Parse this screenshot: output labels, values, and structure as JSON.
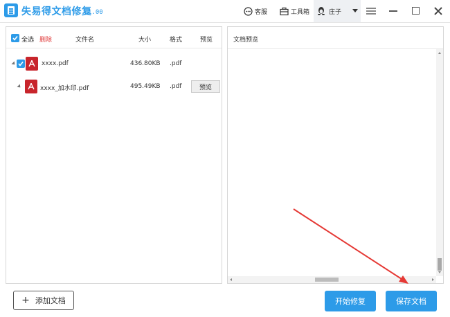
{
  "titlebar": {
    "title": "失易得文档修复",
    "version": "1.00",
    "kefu_label": "客服",
    "tools_label": "工具箱",
    "user_name": "庄子"
  },
  "file_list": {
    "select_all_label": "全选",
    "delete_label": "删除",
    "columns": [
      "文件名",
      "大小",
      "格式",
      "预览"
    ],
    "rows": [
      {
        "name": "xxxx.pdf",
        "size": "436.80KB",
        "format": ".pdf",
        "checked": true,
        "has_preview": false
      },
      {
        "name": "xxxx_加水印.pdf",
        "size": "495.49KB",
        "format": ".pdf",
        "checked": false,
        "has_preview": true,
        "preview_label": "预览"
      }
    ]
  },
  "preview_panel": {
    "title": "文档预览"
  },
  "footer": {
    "add_label": "添加文档",
    "start_label": "开始修复",
    "save_label": "保存文档"
  },
  "colors": {
    "accent": "#2d9be8",
    "delete": "#e03b3b",
    "pdf": "#c8252c",
    "annotation_arrow": "#e53935"
  },
  "icons": [
    "app-logo-icon",
    "chat-icon",
    "toolbox-icon",
    "penguin-user-icon",
    "chevron-down-icon",
    "menu-icon",
    "minimize-icon",
    "maximize-icon",
    "close-icon",
    "checkbox-icon",
    "expand-icon",
    "pdf-file-icon",
    "plus-icon"
  ]
}
